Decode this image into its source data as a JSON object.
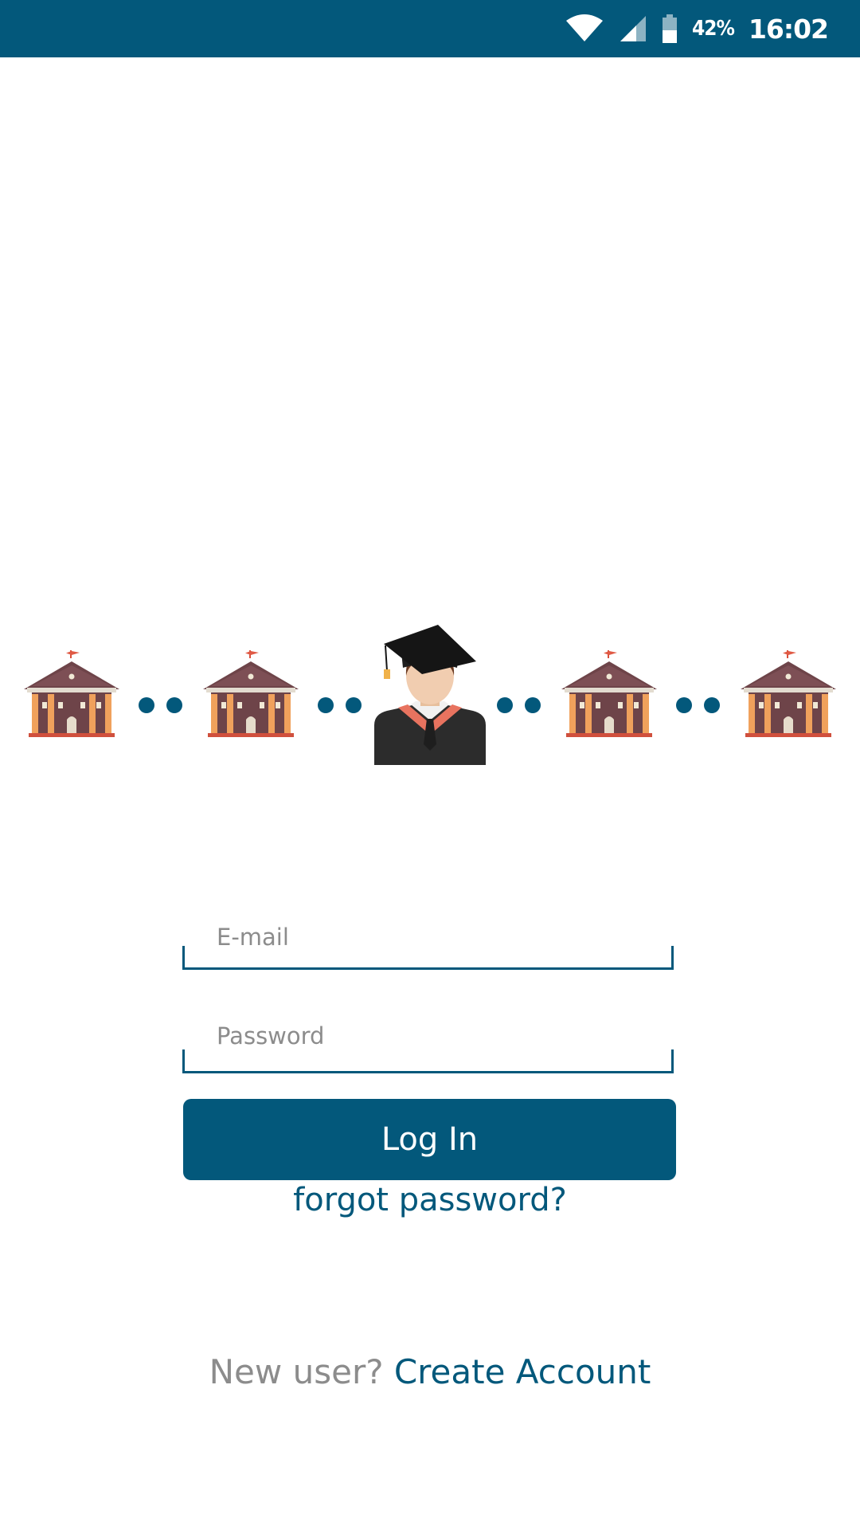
{
  "status_bar": {
    "battery_percent": "42%",
    "time": "16:02",
    "icons": [
      "wifi-icon",
      "cellular-signal-icon",
      "battery-icon"
    ]
  },
  "hero": {
    "icons": [
      "university-building-icon",
      "dots-icon",
      "university-building-icon",
      "dots-icon",
      "graduate-student-icon",
      "dots-icon",
      "university-building-icon",
      "dots-icon",
      "university-building-icon"
    ]
  },
  "form": {
    "email_placeholder": "E-mail",
    "email_value": "",
    "password_placeholder": "Password",
    "password_value": "",
    "login_label": "Log In",
    "forgot_label": "forgot password?",
    "new_user_prompt": "New user?",
    "create_account_label": "Create Account"
  },
  "colors": {
    "primary": "#03587b",
    "placeholder_text": "#8c8c8c",
    "background": "#ffffff"
  }
}
